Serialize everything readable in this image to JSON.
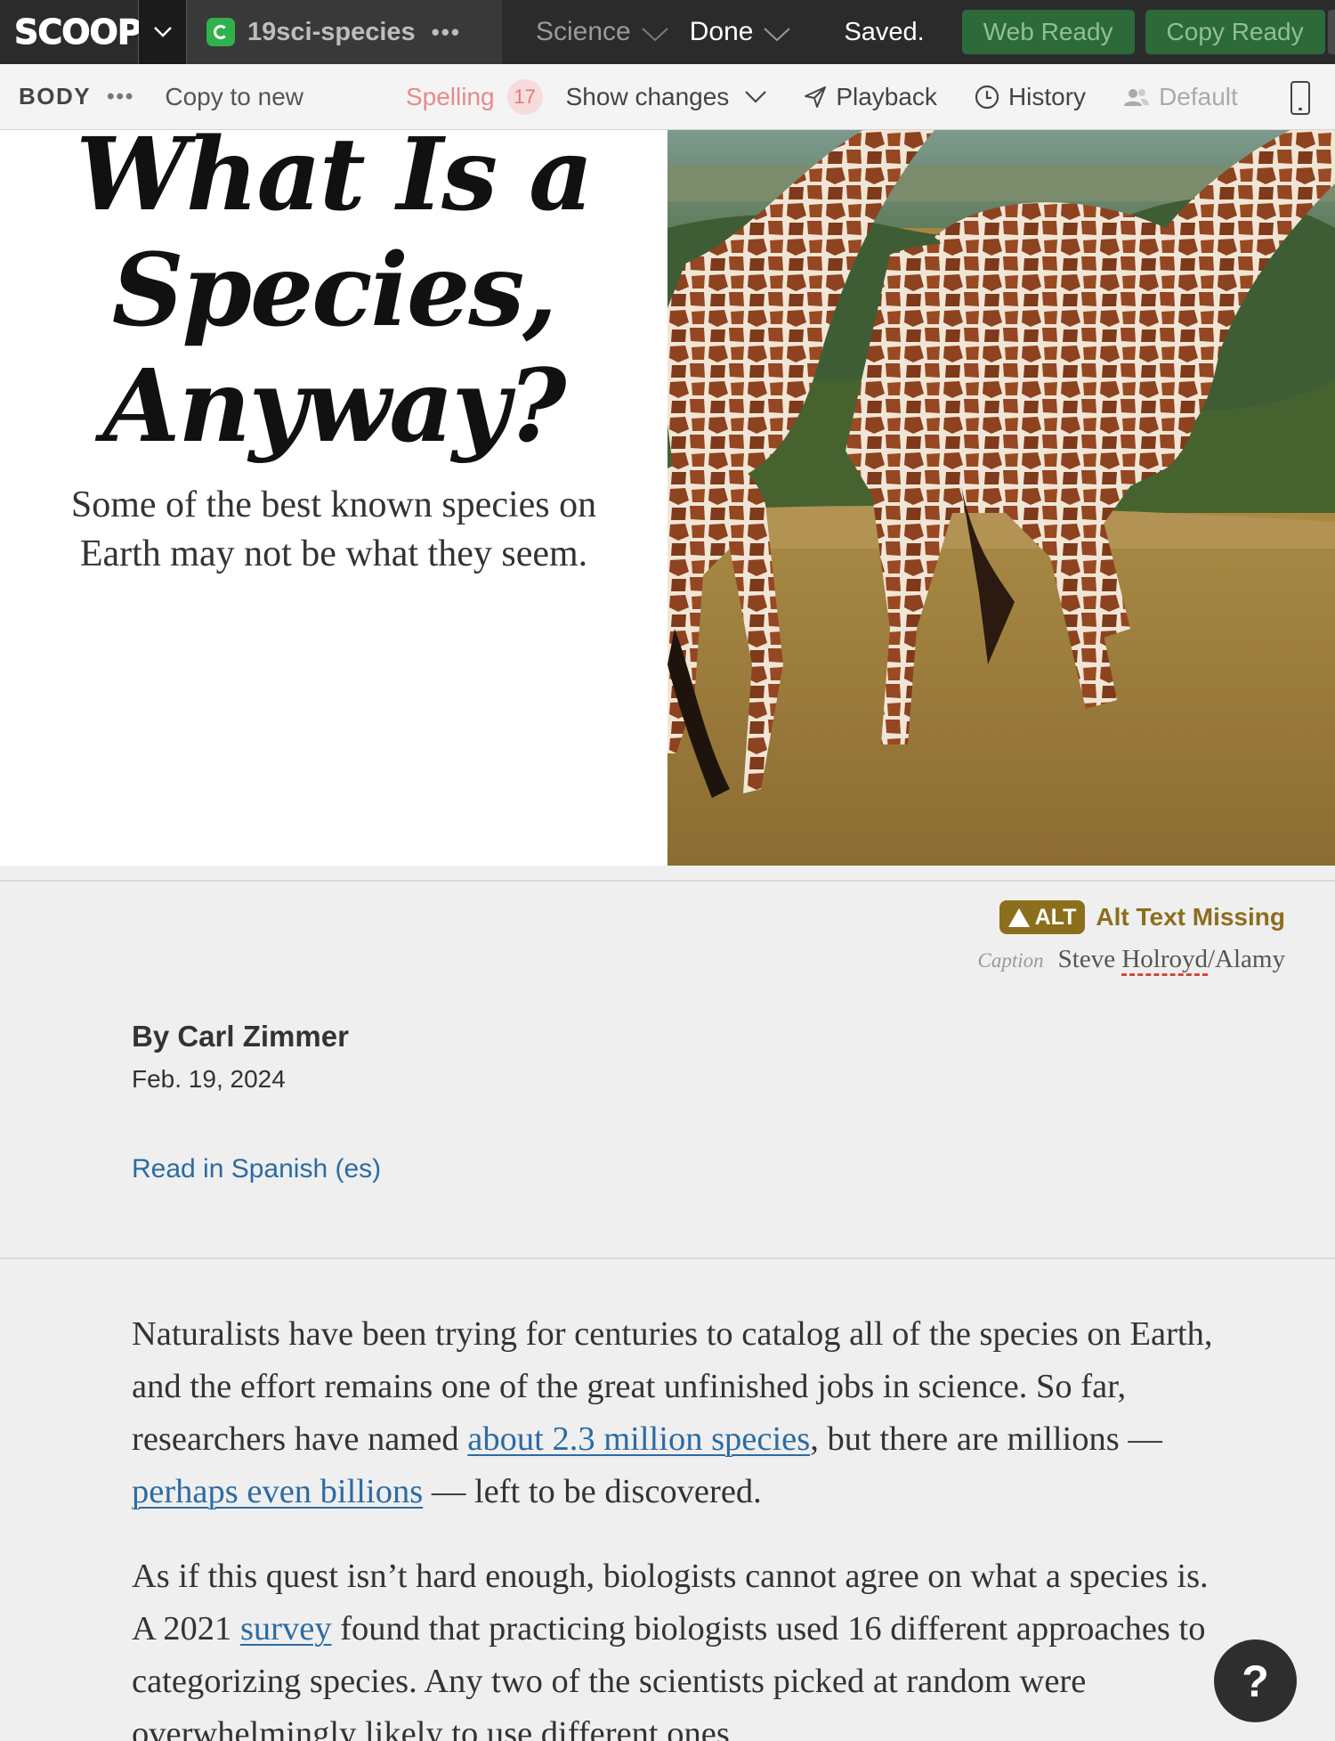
{
  "topbar": {
    "logo": "SCOOP",
    "slug": "19sci-species",
    "section": "Science",
    "status": "Done",
    "saved": "Saved.",
    "web_ready": "Web Ready",
    "copy_ready": "Copy Ready"
  },
  "toolbar": {
    "body": "BODY",
    "copy_to_new": "Copy to new",
    "spelling": "Spelling",
    "spelling_count": "17",
    "show_changes": "Show changes",
    "playback": "Playback",
    "history": "History",
    "default": "Default"
  },
  "article": {
    "headline_line1": "What Is a",
    "headline_line2": "Species,",
    "headline_line3": "Anyway?",
    "summary": "Some of the best known species on Earth may not be what they seem.",
    "alt_badge": "ALT",
    "alt_missing": "Alt Text Missing",
    "caption_label": "Caption",
    "credit_pre": "Steve ",
    "credit_flagged": "Holroyd",
    "credit_post": "/Alamy",
    "byline": "By Carl Zimmer",
    "date": "Feb. 19, 2024",
    "translation_link": "Read in Spanish (es)",
    "p1_a": "Naturalists have been trying for centuries to catalog all of the species on Earth, and the effort remains one of the great unfinished jobs in science. So far, researchers have named ",
    "p1_link1": "about 2.3 million species",
    "p1_b": ", but there are millions — ",
    "p1_link2": "perhaps even billions",
    "p1_c": " — left to be discovered.",
    "p2_a": "As if this quest isn’t hard enough, biologists cannot agree on what a species is. A 2021 ",
    "p2_link": "survey",
    "p2_b": " found that practicing biologists used 16 different approaches to categorizing species. Any two of the scientists picked at random were overwhelmingly likely to use different ones."
  },
  "help": "?",
  "colors": {
    "topbar": "#2b2b2b",
    "ready_button": "#2d6a3a",
    "alt_warning": "#8c6f1c",
    "link": "#2c6ba3",
    "spelling": "#e88a8a"
  },
  "icons": [
    "chevron-down-icon",
    "refresh-icon",
    "more-dots-icon",
    "paper-plane-icon",
    "clock-icon",
    "people-icon",
    "phone-icon",
    "warning-icon",
    "help-icon"
  ]
}
